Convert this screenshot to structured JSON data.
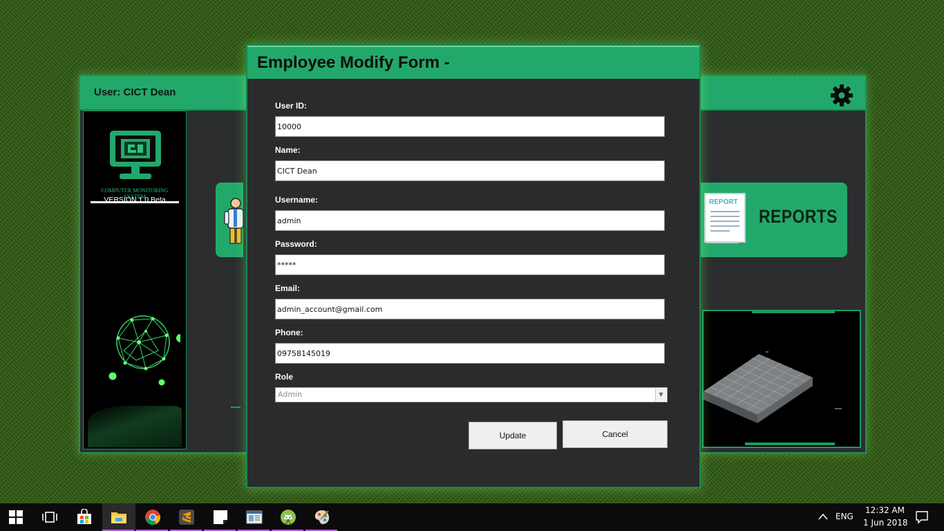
{
  "background_window": {
    "user_label": "User: CICT Dean",
    "logo_text": "COMPUTER MONITORING SYSTEM",
    "version": "VERSION 1.0 Beta",
    "reports_tile": {
      "doc_label": "REPORT",
      "label": "REPORTS"
    }
  },
  "dialog": {
    "title": "Employee Modify Form -",
    "fields": {
      "user_id": {
        "label": "User ID:",
        "value": "10000"
      },
      "name": {
        "label": "Name:",
        "value": "CICT Dean"
      },
      "username": {
        "label": "Username:",
        "value": "admin"
      },
      "password": {
        "label": "Password:",
        "value": "*****"
      },
      "email": {
        "label": "Email:",
        "value": "admin_account@gmail.com"
      },
      "phone": {
        "label": "Phone:",
        "value": "09758145019"
      },
      "role": {
        "label": "Role",
        "value": "Admin"
      }
    },
    "buttons": {
      "update": "Update",
      "cancel": "Cancel"
    }
  },
  "taskbar": {
    "language": "ENG",
    "time": "12:32 AM",
    "date": "1 Jun 2018"
  },
  "colors": {
    "accent": "#23a86b",
    "panel": "#2a2b2d",
    "background": "#2f5a14"
  }
}
